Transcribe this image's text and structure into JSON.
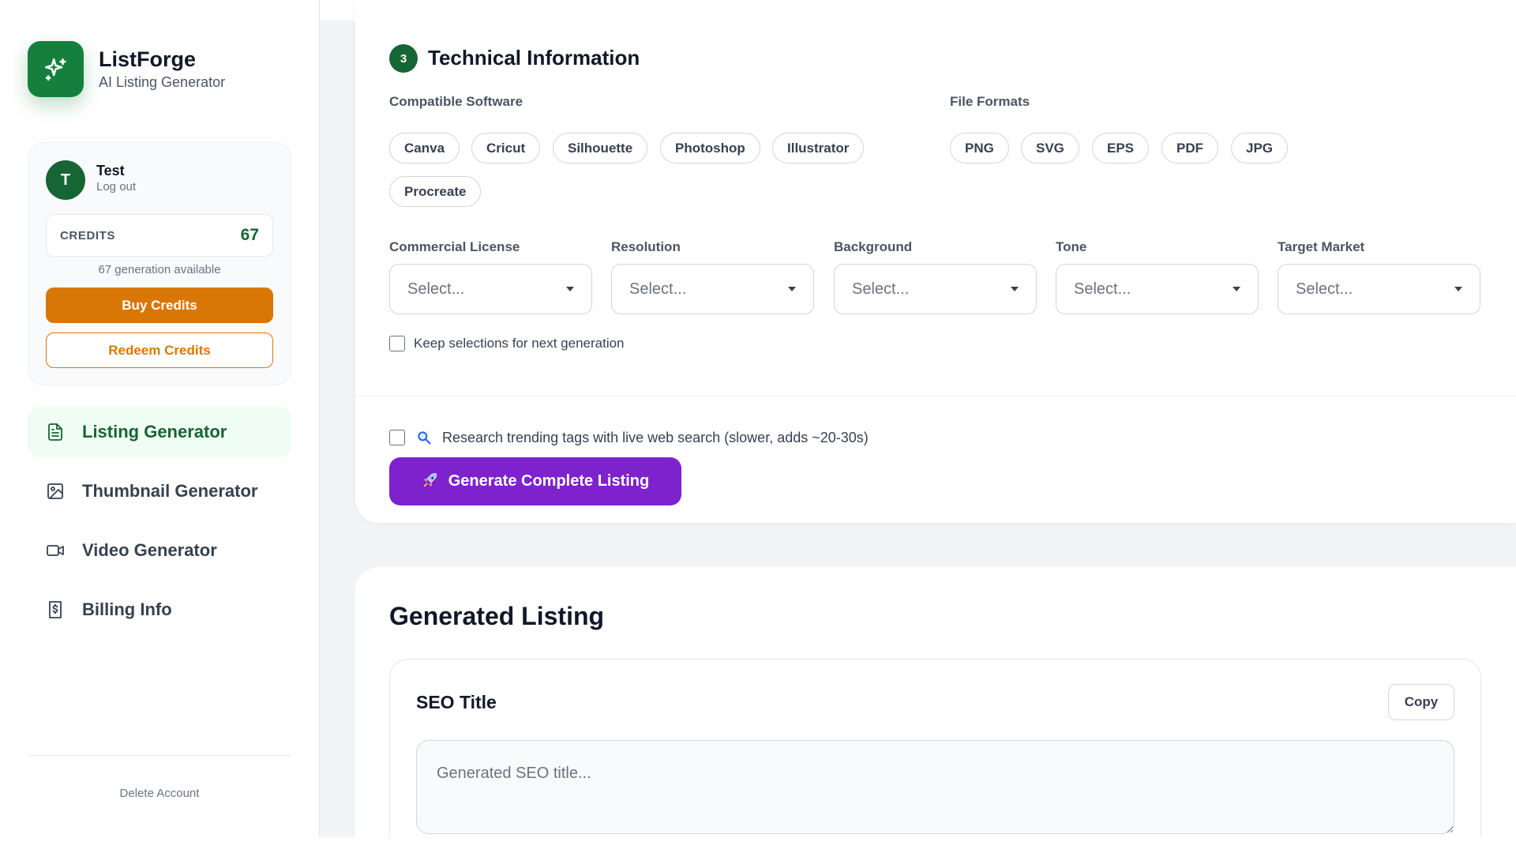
{
  "brand": {
    "name": "ListForge",
    "subtitle": "AI Listing Generator"
  },
  "user": {
    "initial": "T",
    "name": "Test",
    "logout_label": "Log out"
  },
  "credits": {
    "label": "CREDITS",
    "value": "67",
    "available_text": "67 generation available",
    "buy_label": "Buy Credits",
    "redeem_label": "Redeem Credits"
  },
  "nav": {
    "items": [
      {
        "label": "Listing Generator",
        "icon": "file-text-icon",
        "active": true
      },
      {
        "label": "Thumbnail Generator",
        "icon": "image-icon",
        "active": false
      },
      {
        "label": "Video Generator",
        "icon": "video-icon",
        "active": false
      },
      {
        "label": "Billing Info",
        "icon": "receipt-dollar-icon",
        "active": false
      }
    ]
  },
  "footer": {
    "delete_label": "Delete Account"
  },
  "technical": {
    "step": "3",
    "title": "Technical Information",
    "software_label": "Compatible Software",
    "software": [
      "Canva",
      "Cricut",
      "Silhouette",
      "Photoshop",
      "Illustrator",
      "Procreate"
    ],
    "formats_label": "File Formats",
    "formats": [
      "PNG",
      "SVG",
      "EPS",
      "PDF",
      "JPG"
    ],
    "selects": [
      {
        "label": "Commercial License",
        "value": "Select..."
      },
      {
        "label": "Resolution",
        "value": "Select..."
      },
      {
        "label": "Background",
        "value": "Select..."
      },
      {
        "label": "Tone",
        "value": "Select..."
      },
      {
        "label": "Target Market",
        "value": "Select..."
      }
    ],
    "keep_label": "Keep selections for next generation"
  },
  "generate": {
    "research_label": "Research trending tags with live web search (slower, adds ~20-30s)",
    "button_label": "Generate Complete Listing"
  },
  "listing": {
    "title": "Generated Listing",
    "seo_title": "SEO Title",
    "copy_label": "Copy",
    "seo_placeholder": "Generated SEO title..."
  },
  "colors": {
    "brand_green": "#15803d",
    "dark_green": "#166534",
    "orange": "#d97706",
    "purple": "#7e22ce"
  }
}
